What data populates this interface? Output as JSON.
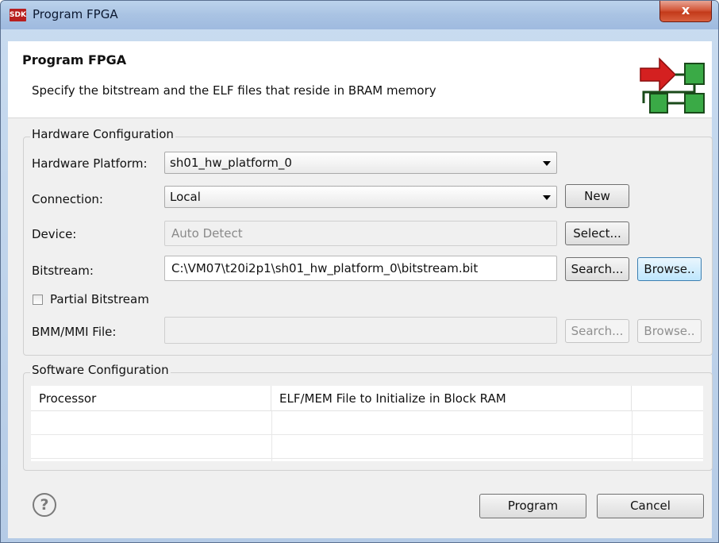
{
  "window": {
    "title": "Program FPGA",
    "app_icon_text": "SDK",
    "close_glyph": "x"
  },
  "header": {
    "title": "Program FPGA",
    "description": "Specify the bitstream and the ELF files that reside in BRAM memory",
    "logo_icon": "fpga-program-icon"
  },
  "hardware": {
    "legend": "Hardware Configuration",
    "platform_label": "Hardware Platform:",
    "platform_value": "sh01_hw_platform_0",
    "connection_label": "Connection:",
    "connection_value": "Local",
    "new_label": "New",
    "device_label": "Device:",
    "device_value": "Auto Detect",
    "select_label": "Select...",
    "bitstream_label": "Bitstream:",
    "bitstream_value": "C:\\VM07\\t20i2p1\\sh01_hw_platform_0\\bitstream.bit",
    "search_label": "Search...",
    "browse_label": "Browse..",
    "partial_label": "Partial Bitstream",
    "partial_checked": false,
    "bmm_label": "BMM/MMI File:",
    "bmm_value": "",
    "bmm_search_label": "Search...",
    "bmm_browse_label": "Browse.."
  },
  "software": {
    "legend": "Software Configuration",
    "columns": [
      "Processor",
      "ELF/MEM File to Initialize in Block RAM",
      ""
    ],
    "rows": [
      [
        "",
        "",
        ""
      ],
      [
        "",
        "",
        ""
      ]
    ]
  },
  "footer": {
    "help_glyph": "?",
    "program_label": "Program",
    "cancel_label": "Cancel"
  },
  "colors": {
    "logo_red": "#d42020",
    "logo_green": "#2e9a3a",
    "focus_blue": "#3c7fb1"
  }
}
